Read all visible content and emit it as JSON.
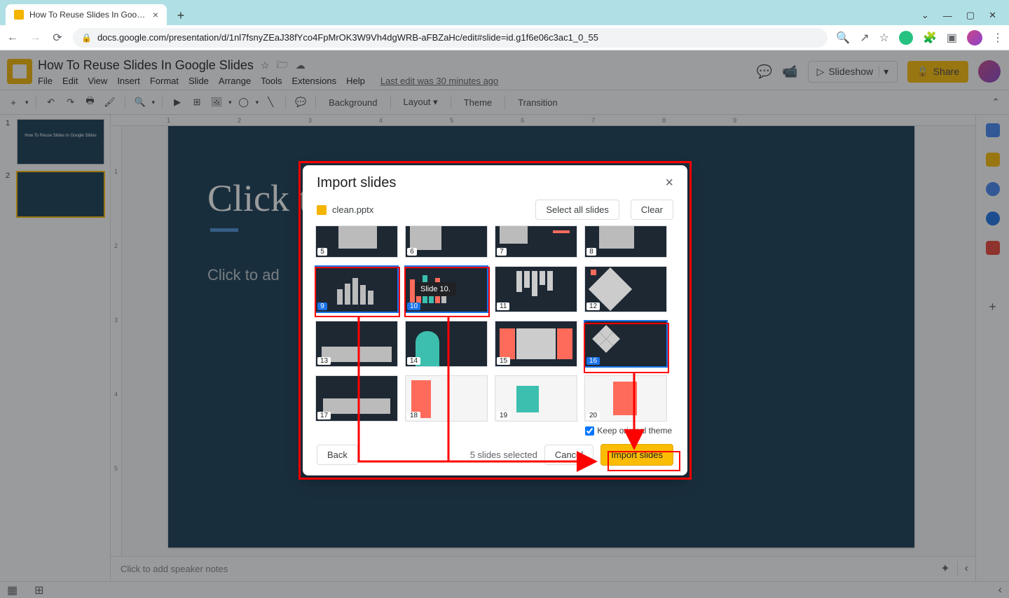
{
  "browser": {
    "tab_title": "How To Reuse Slides In Google S",
    "url": "docs.google.com/presentation/d/1nl7fsnyZEaJ38fYco4FpMrOK3W9Vh4dgWRB-aFBZaHc/edit#slide=id.g1f6e06c3ac1_0_55"
  },
  "app": {
    "doc_title": "How To Reuse Slides In Google Slides",
    "menus": [
      "File",
      "Edit",
      "View",
      "Insert",
      "Format",
      "Slide",
      "Arrange",
      "Tools",
      "Extensions",
      "Help"
    ],
    "last_edit": "Last edit was 30 minutes ago",
    "slideshow_btn": "Slideshow",
    "share_btn": "Share"
  },
  "toolbar": {
    "background": "Background",
    "layout": "Layout",
    "theme": "Theme",
    "transition": "Transition"
  },
  "filmstrip": {
    "slides": [
      {
        "num": "1",
        "label": "How To Reuse Slides In\nGoogle Slides"
      },
      {
        "num": "2",
        "label": ""
      }
    ]
  },
  "canvas": {
    "title_placeholder": "Click t",
    "subtitle_placeholder": "Click to ad"
  },
  "ruler_h": [
    "1",
    "2",
    "3",
    "4",
    "5",
    "6",
    "7",
    "8",
    "9"
  ],
  "ruler_v": [
    "1",
    "2",
    "3",
    "4",
    "5"
  ],
  "speaker_notes_placeholder": "Click to add speaker notes",
  "modal": {
    "title": "Import slides",
    "filename": "clean.pptx",
    "select_all": "Select all slides",
    "clear": "Clear",
    "visible_slides": [
      5,
      6,
      7,
      8,
      9,
      10,
      11,
      12,
      13,
      14,
      15,
      16,
      17,
      18,
      19,
      20
    ],
    "selected_slides": [
      9,
      10,
      16
    ],
    "tooltip": "Slide 10.",
    "keep_theme_label": "Keep original theme",
    "keep_theme_checked": true,
    "back": "Back",
    "selected_text": "5 slides selected",
    "cancel": "Cancel",
    "import": "Import slides"
  }
}
